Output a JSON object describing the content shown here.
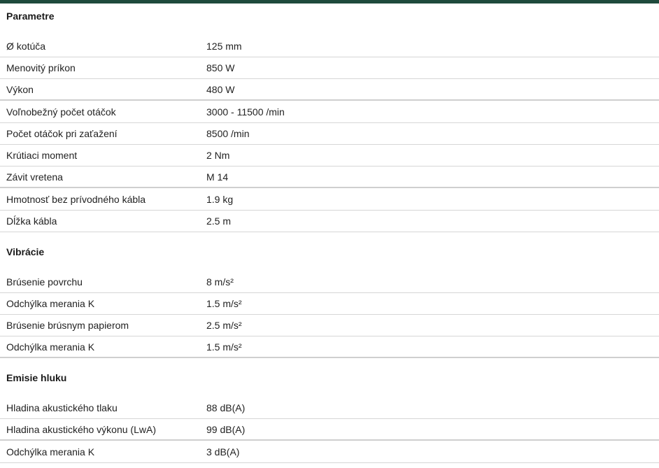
{
  "sections": [
    {
      "title": "Parametre",
      "rows": [
        {
          "label": "Ø kotúča",
          "value": "125 mm"
        },
        {
          "label": "Menovitý príkon",
          "value": "850 W"
        },
        {
          "label": "Výkon",
          "value": "480 W"
        },
        {
          "label": "Voľnobežný počet otáčok",
          "value": "3000 - 11500 /min"
        },
        {
          "label": "Počet otáčok pri zaťažení",
          "value": "8500 /min"
        },
        {
          "label": "Krútiaci moment",
          "value": "2 Nm"
        },
        {
          "label": "Závit vretena",
          "value": "M 14"
        },
        {
          "label": "Hmotnosť bez prívodného kábla",
          "value": "1.9 kg"
        },
        {
          "label": "Dĺžka kábla",
          "value": "2.5 m"
        }
      ]
    },
    {
      "title": "Vibrácie",
      "rows": [
        {
          "label": "Brúsenie povrchu",
          "value": "8 m/s²"
        },
        {
          "label": "Odchýlka merania K",
          "value": "1.5 m/s²"
        },
        {
          "label": "Brúsenie brúsnym papierom",
          "value": "2.5 m/s²"
        },
        {
          "label": "Odchýlka merania K",
          "value": "1.5 m/s²"
        }
      ]
    },
    {
      "title": "Emisie hluku",
      "rows": [
        {
          "label": "Hladina akustického tlaku",
          "value": "88 dB(A)"
        },
        {
          "label": "Hladina akustického výkonu (LwA)",
          "value": "99 dB(A)"
        },
        {
          "label": "Odchýlka merania K",
          "value": "3 dB(A)"
        }
      ]
    }
  ],
  "colors": {
    "top_bar": "#1f4a3c",
    "divider": "#d6d6d6",
    "text": "#222222"
  }
}
